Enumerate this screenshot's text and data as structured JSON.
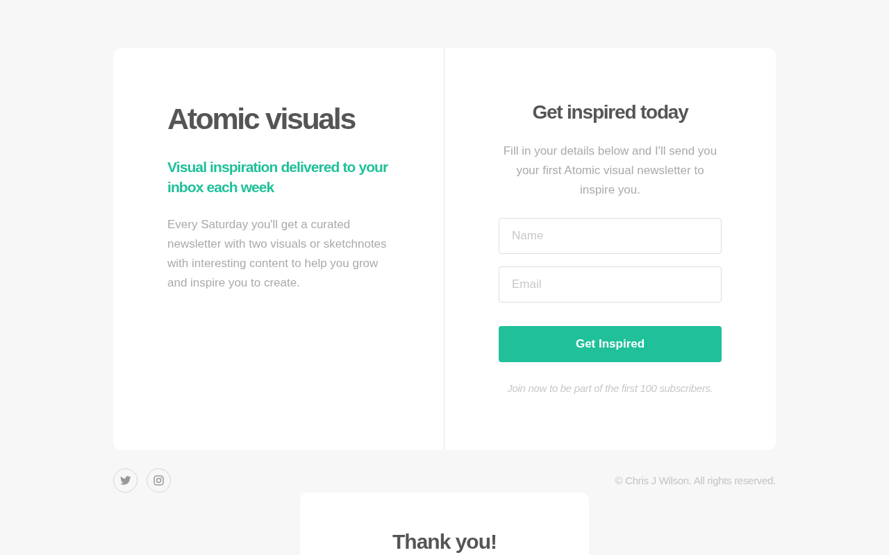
{
  "hero": {
    "title": "Atomic visuals",
    "tagline": "Visual inspiration delivered to your inbox each week",
    "description": "Every Saturday you'll get a curated newsletter with two visuals or sketchnotes with interesting content to help you grow and inspire you to create."
  },
  "signup": {
    "title": "Get inspired today",
    "intro": "Fill in your details below and I'll send you your first Atomic visual newsletter to inspire you.",
    "fields": [
      {
        "placeholder": "Name"
      },
      {
        "placeholder": "Email"
      }
    ],
    "button": "Get Inspired",
    "note": "Join now to be part of the first 100 subscribers."
  },
  "footer": {
    "social_links": [
      {
        "kind": "twitter"
      },
      {
        "kind": "instagram"
      }
    ],
    "copyright": "© Chris J Wilson. All rights reserved."
  },
  "thank_you": {
    "title": "Thank you!"
  }
}
